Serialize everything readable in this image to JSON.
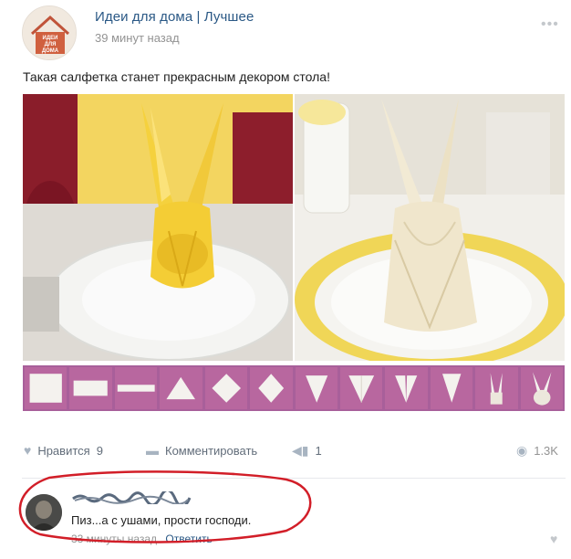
{
  "group": {
    "name": "Идеи для дома | Лучшее",
    "time": "39 минут назад",
    "avatar_text": [
      "ИДЕИ",
      "ДЛЯ",
      "ДОМА"
    ]
  },
  "post": {
    "text": "Такая салфетка станет прекрасным декором стола!"
  },
  "actions": {
    "like_label": "Нравится",
    "like_count": "9",
    "comment_label": "Комментировать",
    "share_count": "1",
    "views": "1.3K"
  },
  "comment": {
    "text": "Пиз...а с ушами, прости господи.",
    "time": "33 минуты назад",
    "reply_label": "Ответить"
  },
  "icons": {
    "more": "more-dots-icon",
    "like": "heart-icon",
    "comment": "comment-icon",
    "share": "megaphone-icon",
    "views": "eye-icon"
  },
  "colors": {
    "link": "#2a5885",
    "muted": "#939393",
    "strip": "#a85f9a",
    "annotation": "#d21e28"
  }
}
